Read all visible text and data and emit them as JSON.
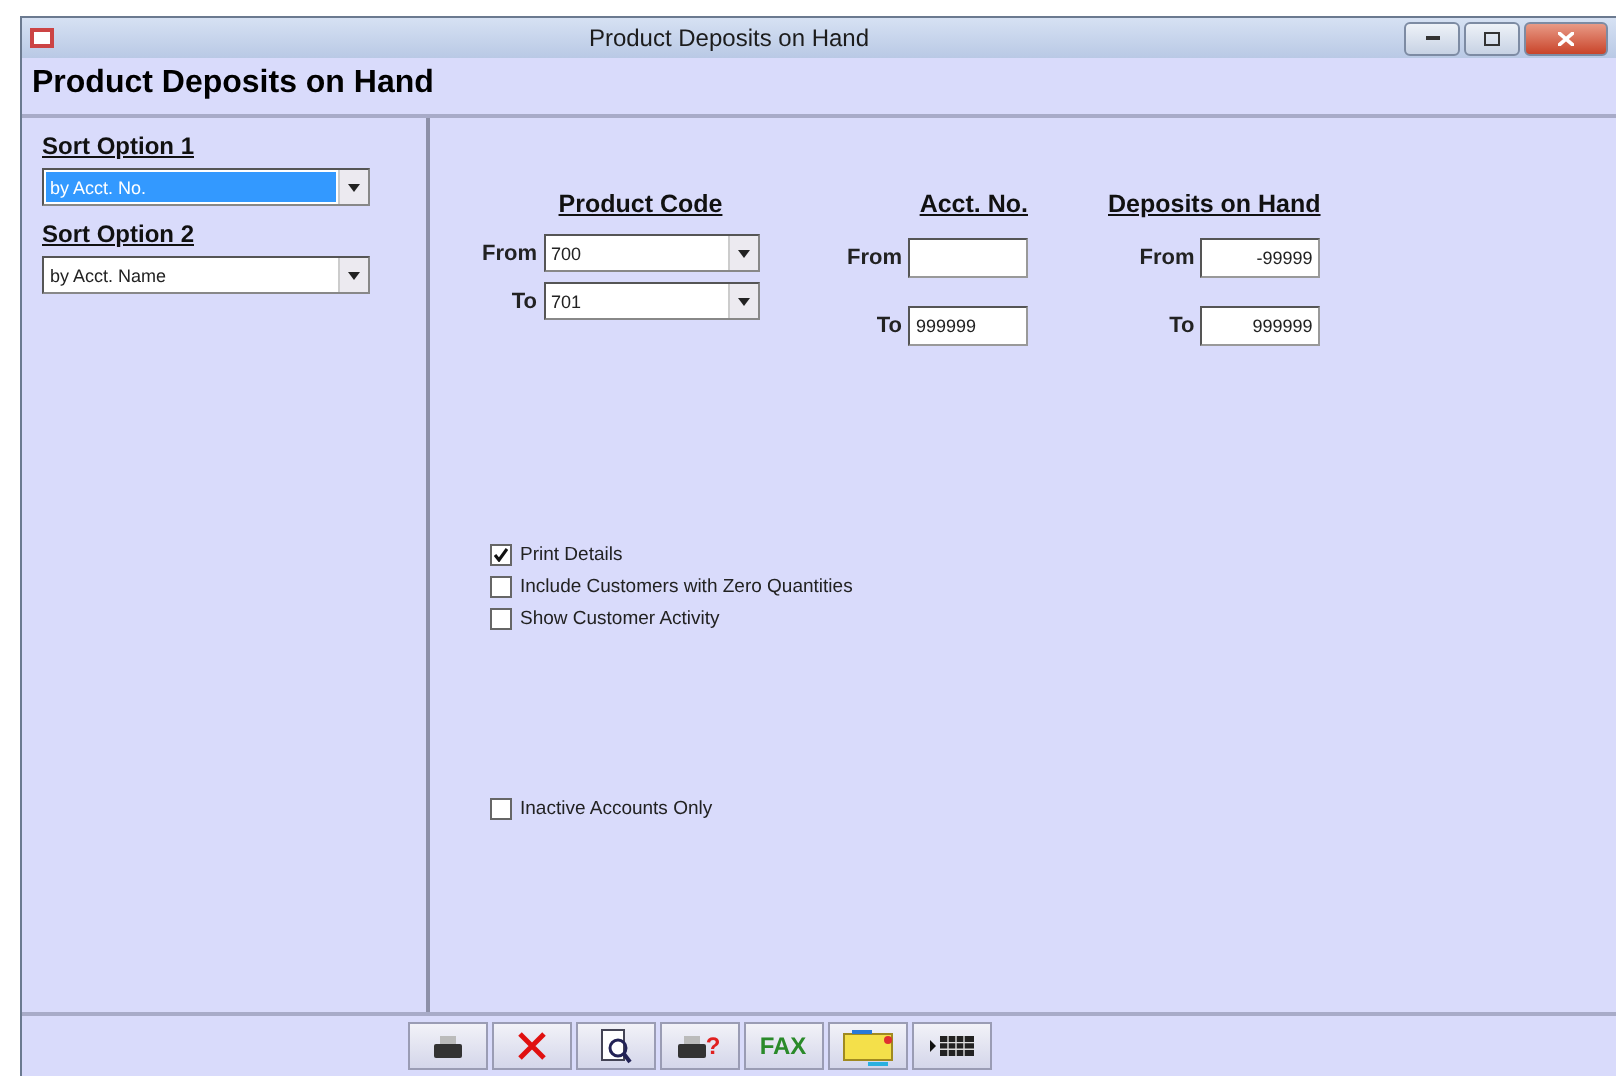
{
  "window": {
    "title": "Product Deposits on Hand"
  },
  "heading": "Product Deposits on Hand",
  "sort_options": [
    {
      "label": "Sort Option 1",
      "value": "by Acct. No.",
      "focused": true
    },
    {
      "label": "Sort Option 2",
      "value": "by Acct. Name",
      "focused": false
    }
  ],
  "ranges": [
    {
      "title": "Product Code",
      "kind": "dropdown",
      "from_label": "From",
      "from": "700",
      "to_label": "To",
      "to": "701"
    },
    {
      "title": "Acct. No.",
      "kind": "text",
      "from_label": "From",
      "to_label": "To",
      "to": "999999"
    },
    {
      "title": "Deposits on Hand",
      "kind": "number",
      "from_label": "From",
      "from": "-99999",
      "to_label": "To",
      "to": "999999"
    }
  ],
  "options": [
    {
      "label": "Print Details",
      "checked": true
    },
    {
      "label": "Include Customers with Zero Quantities",
      "checked": false
    },
    {
      "label": "Show Customer Activity",
      "checked": false
    }
  ],
  "extra_options": [
    {
      "label": "Inactive Accounts Only",
      "checked": false
    }
  ],
  "toolbar": [
    {
      "kind": "print"
    },
    {
      "kind": "cancel"
    },
    {
      "kind": "preview"
    },
    {
      "kind": "print-help",
      "label": "?"
    },
    {
      "kind": "text",
      "label": "FAX"
    },
    {
      "kind": "transfer"
    },
    {
      "kind": "grid"
    }
  ]
}
